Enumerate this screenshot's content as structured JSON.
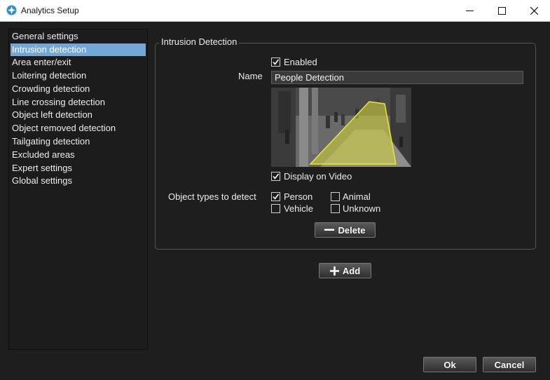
{
  "window": {
    "title": "Analytics Setup",
    "app_icon": "analytics-app-icon",
    "controls": [
      "minimize-icon",
      "maximize-icon",
      "close-icon"
    ]
  },
  "sidebar": {
    "items": [
      {
        "label": "General settings",
        "selected": false
      },
      {
        "label": "Intrusion detection",
        "selected": true
      },
      {
        "label": "Area enter/exit",
        "selected": false
      },
      {
        "label": "Loitering detection",
        "selected": false
      },
      {
        "label": "Crowding detection",
        "selected": false
      },
      {
        "label": "Line crossing detection",
        "selected": false
      },
      {
        "label": "Object left detection",
        "selected": false
      },
      {
        "label": "Object removed detection",
        "selected": false
      },
      {
        "label": "Tailgating detection",
        "selected": false
      },
      {
        "label": "Excluded areas",
        "selected": false
      },
      {
        "label": "Expert settings",
        "selected": false
      },
      {
        "label": "Global settings",
        "selected": false
      }
    ]
  },
  "rule": {
    "group_title": "Intrusion Detection",
    "enabled_label": "Enabled",
    "enabled": true,
    "name_label": "Name",
    "name_value": "People Detection",
    "display_on_video_label": "Display on Video",
    "display_on_video": true,
    "object_types_label": "Object types to detect",
    "object_types": {
      "person": {
        "label": "Person",
        "checked": true
      },
      "animal": {
        "label": "Animal",
        "checked": false
      },
      "vehicle": {
        "label": "Vehicle",
        "checked": false
      },
      "unknown": {
        "label": "Unknown",
        "checked": false
      }
    },
    "delete_label": "Delete"
  },
  "add_label": "Add",
  "footer": {
    "ok_label": "Ok",
    "cancel_label": "Cancel"
  },
  "colors": {
    "accent_selection": "#72a7d7",
    "zone_fill": "#d8d83a",
    "background": "#1e1e1e"
  }
}
